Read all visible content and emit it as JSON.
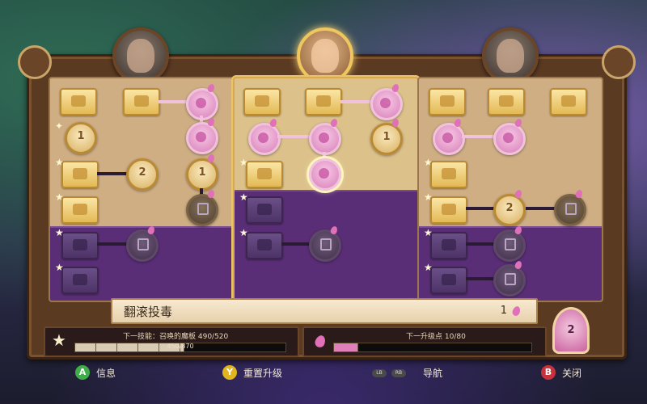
{
  "tooltip": {
    "skill_name": "翻滚投毒",
    "cost": "1"
  },
  "xp_panel": {
    "label": "下一技能：召唤的魔板 490/520",
    "progress_text": "450/870",
    "progress_fraction": 0.52
  },
  "points_panel": {
    "label": "下一升级点 10/80",
    "progress_fraction": 0.125
  },
  "nodes": {
    "n1": "1",
    "n2": "2",
    "n3": "1",
    "n4": "1",
    "n5": "2"
  },
  "controls": {
    "info": {
      "key": "A",
      "label": "信息"
    },
    "reset": {
      "key": "Y",
      "label": "重置升级"
    },
    "navigate": {
      "key_left": "LB",
      "key_right": "RB",
      "label": "导航"
    },
    "close": {
      "key": "B",
      "label": "关闭"
    }
  },
  "badge": {
    "value": "2"
  },
  "colors": {
    "frame": "#5b3a22",
    "column": "#cfae84",
    "locked_region": "#5a2e77",
    "gold_tile": "#e3b955",
    "pink_node": "#d87fb8",
    "button_a": "#3fae49",
    "button_y": "#e1b51e",
    "button_b": "#c8323a"
  },
  "icons": {
    "portrait_left": "wizard-portrait",
    "portrait_center": "priestess-portrait",
    "portrait_right": "knight-portrait",
    "drop": "potion-drop-icon",
    "star": "star-icon",
    "lock": "padlock-icon"
  }
}
